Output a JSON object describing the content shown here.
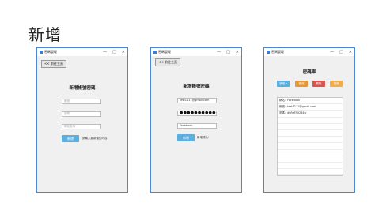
{
  "slide_title": "新增",
  "window_title": "密碼管理",
  "window_controls": [
    "—",
    "□",
    "✕"
  ],
  "window1": {
    "back_label": "<< 前往主頁",
    "heading": "新增帳號密碼",
    "placeholders": [
      "帳號",
      "密碼",
      "網站名稱"
    ],
    "submit_label": "新增",
    "hint": "請輸入要新增的內容"
  },
  "window2": {
    "back_label": "<< 前往主頁",
    "heading": "新增帳號密碼",
    "account_value": "test1111@gmail.com",
    "password_value": "●●●●●●●●●●●●●●●●",
    "site_value": "Facebook",
    "submit_label": "新增",
    "hint": "新增成功!"
  },
  "window3": {
    "heading": "密碼庫",
    "buttons": [
      {
        "label": "新增 ▾",
        "color": "#5aaee0"
      },
      {
        "label": "修改",
        "color": "#e09a3c"
      },
      {
        "label": "刪除",
        "color": "#d9534f"
      },
      {
        "label": "搜尋",
        "color": "#f0ad4e"
      }
    ],
    "rows": [
      "網站：Facebook",
      "帳號：test1111@gmail.com",
      "密碼：dhFe7R0234fc"
    ],
    "empty_rows": 10
  }
}
